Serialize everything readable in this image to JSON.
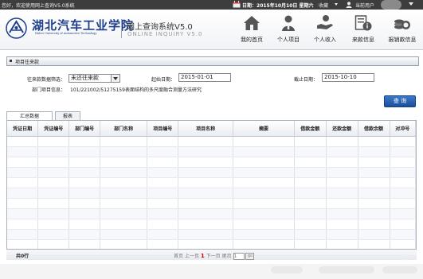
{
  "topbar": {
    "welcome": "您好，欢迎使用网上查询V5.0系统",
    "date_label": "日期：",
    "date": "2015年10月10日 星期六",
    "favorites": "收藏",
    "user": "当前用户"
  },
  "header": {
    "school_name": "湖北汽车工业学院",
    "school_name_en": "Hubei University of Automotive Technology",
    "system_name": "网上查询系统V5.0",
    "system_name_en": "ONLINE INQUIRY V5.0"
  },
  "nav": [
    {
      "label": "我的首页",
      "icon": "home-icon"
    },
    {
      "label": "个人项目",
      "icon": "person-project-icon"
    },
    {
      "label": "个人收入",
      "icon": "income-icon"
    },
    {
      "label": "来款信息",
      "icon": "info-icon"
    },
    {
      "label": "报销款信息",
      "icon": "coins-icon"
    }
  ],
  "section": {
    "title": "项目往来款"
  },
  "filters": {
    "type_label": "往来款数据筛选：",
    "type_value": "未还往来款",
    "start_label": "起始日期：",
    "start_value": "2015-01-01",
    "end_label": "截止日期：",
    "end_value": "2015-10-10",
    "dept_label": "部门项目信息：",
    "dept_value": "101/221002/51275159表面结构的多尺度融合测量方法研究",
    "query_button": "查 询"
  },
  "tabs": [
    {
      "label": "汇总数据",
      "active": true
    },
    {
      "label": "报表",
      "active": false
    }
  ],
  "table": {
    "columns": [
      "凭证日期",
      "凭证编号",
      "部门编号",
      "部门名称",
      "项目编号",
      "项目名称",
      "摘要",
      "借款金额",
      "还款金额",
      "借款余额",
      "对冲号"
    ],
    "row_count_visible": 13
  },
  "footer": {
    "total": "共0行",
    "first": "首页",
    "prev": "上一页",
    "current": "1",
    "next": "下一页",
    "last": "尾页",
    "page_input": "1",
    "go": "go"
  },
  "colors": {
    "accent": "#1b4f9c",
    "topbar": "#3d3d3d",
    "school_blue": "#1e3f8a"
  }
}
